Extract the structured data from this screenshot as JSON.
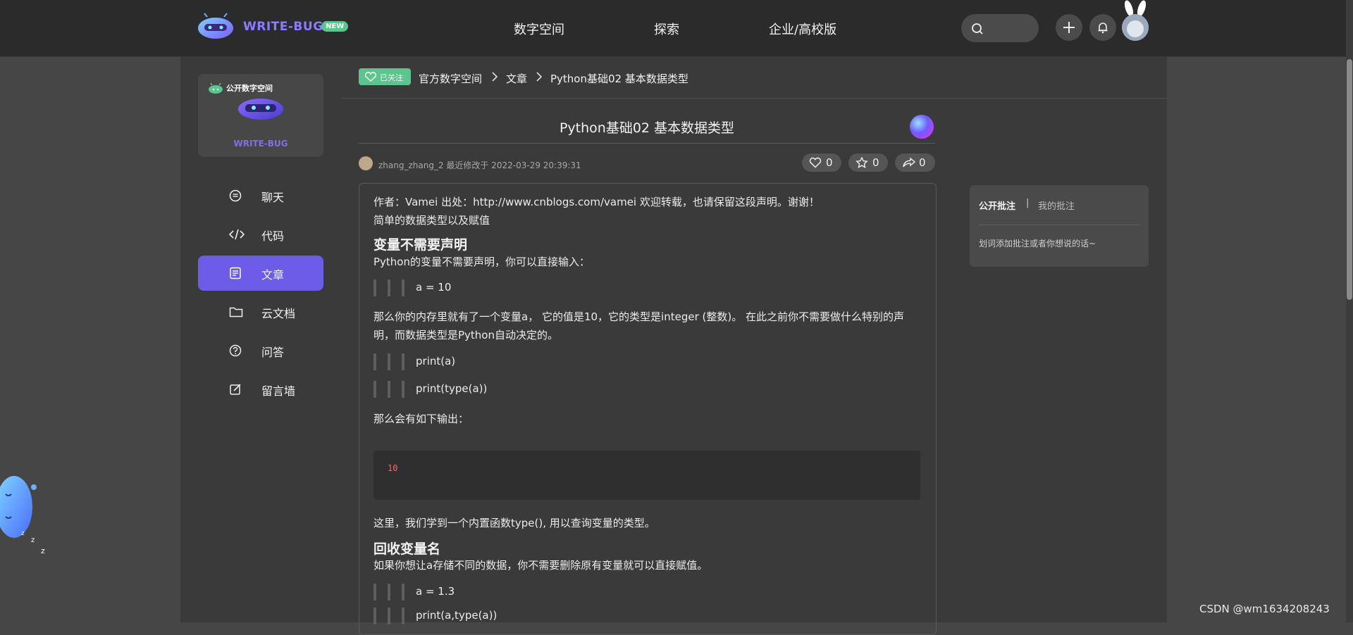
{
  "topbar": {
    "brand": "WRITE-BUG",
    "new_badge": "NEW",
    "nav": [
      "数字空间",
      "探索",
      "企业/高校版"
    ]
  },
  "sidebar": {
    "card_label": "公开数字空间",
    "card_brand": "WRITE-BUG",
    "items": [
      {
        "label": "聊天",
        "icon": "chat-icon"
      },
      {
        "label": "代码",
        "icon": "code-icon"
      },
      {
        "label": "文章",
        "icon": "article-icon",
        "active": true
      },
      {
        "label": "云文档",
        "icon": "folder-icon"
      },
      {
        "label": "问答",
        "icon": "question-icon"
      },
      {
        "label": "留言墙",
        "icon": "edit-icon"
      }
    ]
  },
  "breadcrumb": {
    "follow": "已关注",
    "items": [
      "官方数字空间",
      "文章",
      "Python基础02 基本数据类型"
    ]
  },
  "article": {
    "title": "Python基础02 基本数据类型",
    "meta": "zhang_zhang_2 最近修改于 2022-03-29 20:39:31",
    "likes": "0",
    "stars": "0",
    "shares": "0",
    "p1": "作者：Vamei 出处：http://www.cnblogs.com/vamei 欢迎转载，也请保留这段声明。谢谢！",
    "p2": "简单的数据类型以及赋值",
    "h1": "变量不需要声明",
    "p3": "Python的变量不需要声明，你可以直接输入：",
    "q1": "a = 10",
    "p4": "那么你的内存里就有了一个变量a， 它的值是10，它的类型是integer (整数)。 在此之前你不需要做什么特别的声明，而数据类型是Python自动决定的。",
    "q2": "print(a)",
    "q3": "print(type(a))",
    "p5": "那么会有如下输出：",
    "code": "10",
    "p6": "这里，我们学到一个内置函数type(), 用以查询变量的类型。",
    "h2": "回收变量名",
    "p7": "如果你想让a存储不同的数据，你不需要删除原有变量就可以直接赋值。",
    "q4": "a = 1.3",
    "q5": "print(a,type(a))"
  },
  "annotations": {
    "tab_public": "公开批注",
    "separator": "|",
    "tab_mine": "我的批注",
    "hint": "划词添加批注或者你想说的话~"
  },
  "watermark": "CSDN @wm1634208243",
  "colors": {
    "accent": "#6c5ce7",
    "badge": "#5cc48d",
    "brand": "#8b7bff"
  }
}
